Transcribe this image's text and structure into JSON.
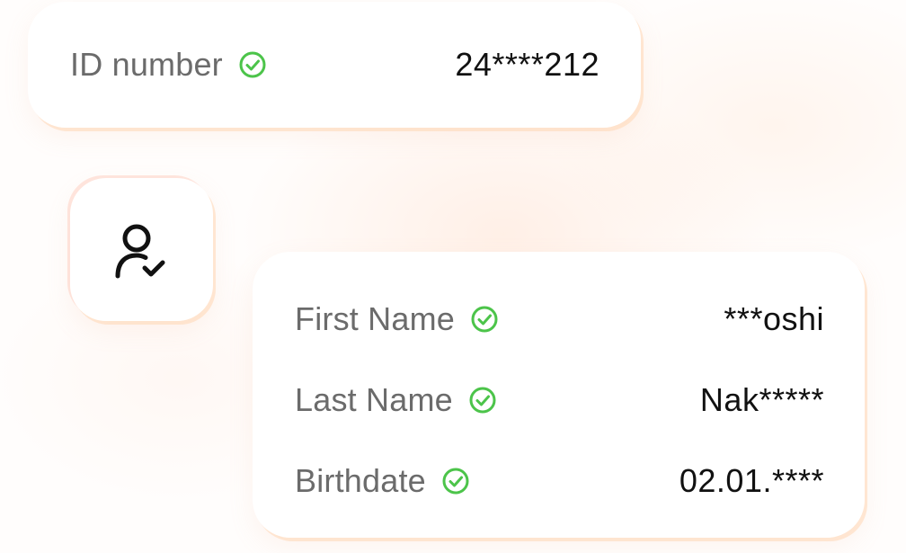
{
  "id_card": {
    "label": "ID number",
    "value": "24****212",
    "verified_icon": "check-circle-icon"
  },
  "avatar": {
    "icon": "user-check-icon"
  },
  "details": {
    "rows": [
      {
        "label": "First Name",
        "value": "***oshi",
        "verified_icon": "check-circle-icon"
      },
      {
        "label": "Last Name",
        "value": "Nak*****",
        "verified_icon": "check-circle-icon"
      },
      {
        "label": "Birthdate",
        "value": "02.01.****",
        "verified_icon": "check-circle-icon"
      }
    ]
  },
  "colors": {
    "verified_green": "#4cc44a",
    "label_gray": "#6b6b6b",
    "value_black": "#111111",
    "accent_glow": "#ffd7b4"
  }
}
